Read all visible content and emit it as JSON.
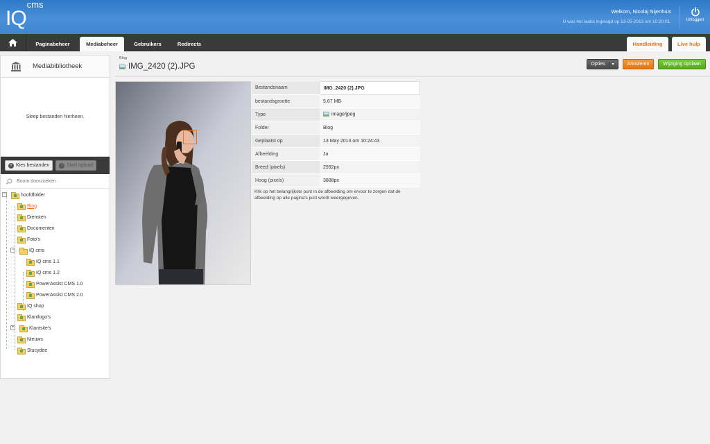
{
  "header": {
    "logo_main": "IQ",
    "logo_sup": "cms",
    "welcome": "Welkom, Nicolaj Nijenhuis",
    "last_login": "U was het laatst ingelogd op 13-05-2013 om 10:20:01.",
    "logout_label": "Uitloggen"
  },
  "nav": {
    "tabs": [
      {
        "label": "Paginabeheer",
        "active": false
      },
      {
        "label": "Mediabeheer",
        "active": true
      },
      {
        "label": "Gebruikers",
        "active": false
      },
      {
        "label": "Redirects",
        "active": false
      }
    ],
    "right_tabs": [
      {
        "label": "Handleiding"
      },
      {
        "label": "Live hulp"
      }
    ]
  },
  "sidebar": {
    "title": "Mediabibliotheek",
    "dropzone_text": "Sleep bestanden hierheen.",
    "choose_files": "Kies bestanden",
    "start_upload": "Start upload",
    "search_placeholder": "Boom doorzoeken",
    "tree": [
      {
        "label": "hoofdfolder",
        "level": 0,
        "toggle": "minus"
      },
      {
        "label": "Blog",
        "level": 1,
        "selected": true
      },
      {
        "label": "Diensten",
        "level": 1
      },
      {
        "label": "Documenten",
        "level": 1
      },
      {
        "label": "Foto's",
        "level": 1
      },
      {
        "label": "IQ cms",
        "level": 1,
        "toggle": "minus"
      },
      {
        "label": "IQ cms 1.1",
        "level": 2
      },
      {
        "label": "IQ cms 1.2",
        "level": 2
      },
      {
        "label": "PowerAssist CMS 1.0",
        "level": 2
      },
      {
        "label": "PowerAssist CMS 2.0",
        "level": 2
      },
      {
        "label": "IQ shop",
        "level": 1
      },
      {
        "label": "Klantlogo's",
        "level": 1
      },
      {
        "label": "Klantsite's",
        "level": 1,
        "toggle": "plus"
      },
      {
        "label": "Nieuws",
        "level": 1
      },
      {
        "label": "Stucydee",
        "level": 1
      }
    ]
  },
  "main": {
    "breadcrumb": "Blog",
    "file_title": "IMG_2420 (2).JPG",
    "buttons": {
      "options": "Opties",
      "cancel": "Annuleren",
      "save": "Wijziging opslaan"
    },
    "properties": [
      {
        "key": "Bestandsnaam",
        "value": "IMG_2420 (2).JPG"
      },
      {
        "key": "bestandsgrootte",
        "value": "5,67 MB"
      },
      {
        "key": "Type",
        "value": "image/jpeg"
      },
      {
        "key": "Folder",
        "value": "Blog"
      },
      {
        "key": "Geplaatst op",
        "value": "13 May 2013 om 10:24:43"
      },
      {
        "key": "Afbeelding",
        "value": "Ja"
      },
      {
        "key": "Breed (pixels)",
        "value": "2592px"
      },
      {
        "key": "Hoog (pixels)",
        "value": "3888px"
      }
    ],
    "note": "Klik op het belangrijkste punt in de afbeelding om ervoor te zorgen dat de afbeelding op alle pagina's juist wordt weergegeven."
  },
  "colors": {
    "accent_orange": "#e8741e",
    "save_green": "#55a81c",
    "header_blue": "#3f86d2",
    "nav_dark": "#3a3a3a"
  }
}
